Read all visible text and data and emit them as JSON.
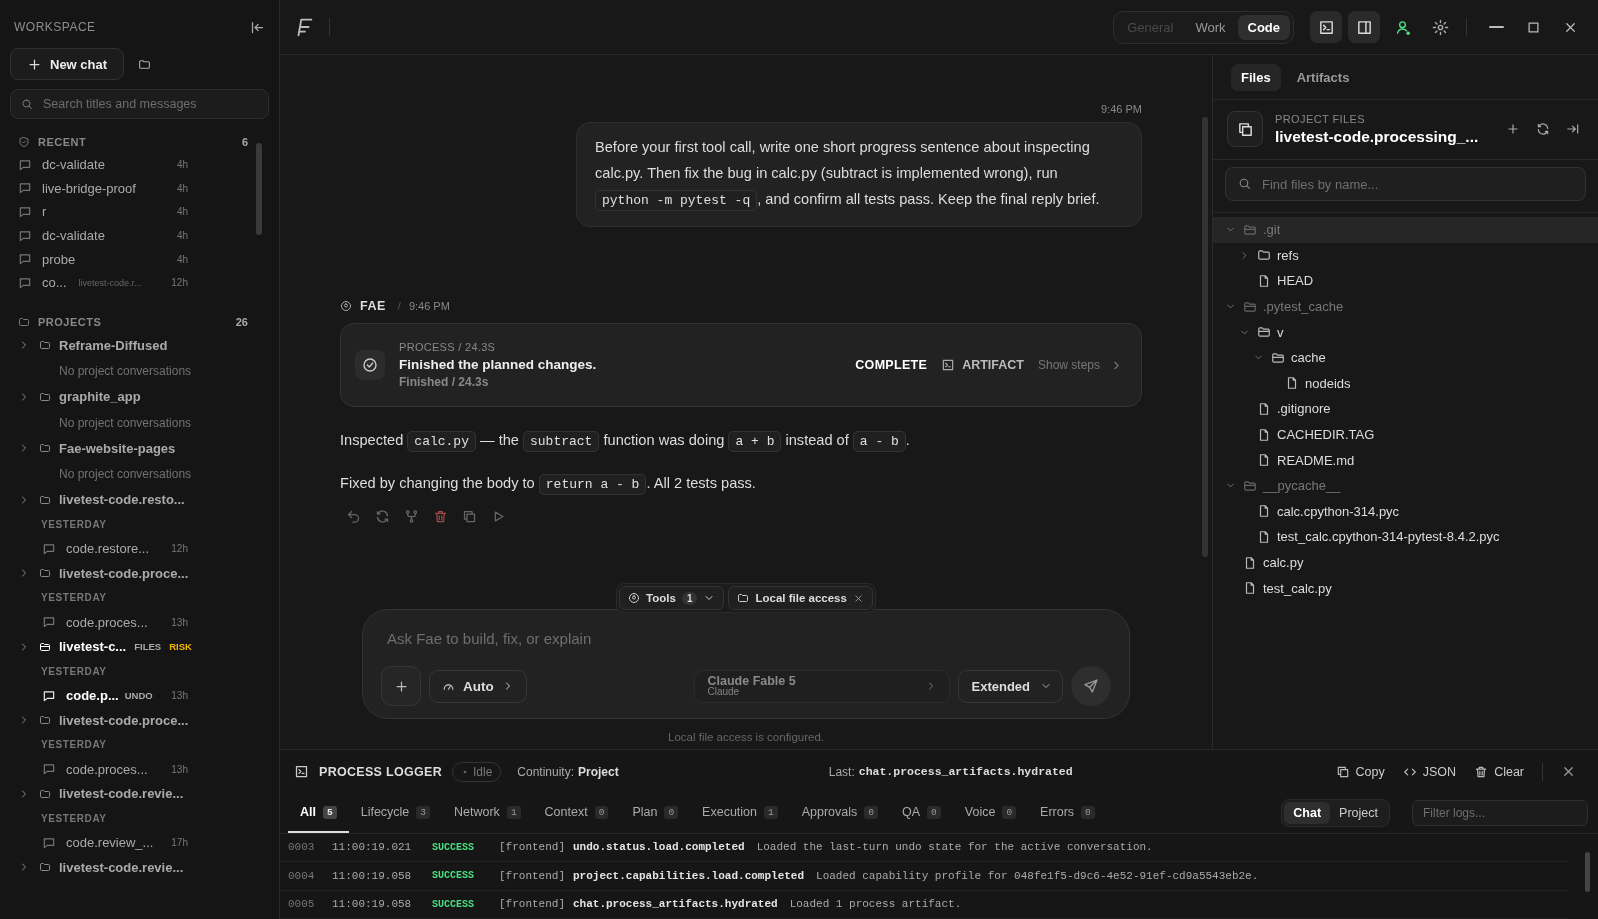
{
  "sidebar": {
    "title": "WORKSPACE",
    "new_chat": "New chat",
    "search_placeholder": "Search titles and messages",
    "recent": {
      "label": "RECENT",
      "count": "6",
      "items": [
        {
          "title": "dc-validate",
          "time": "4h"
        },
        {
          "title": "live-bridge-proof",
          "time": "4h"
        },
        {
          "title": "r",
          "time": "4h"
        },
        {
          "title": "dc-validate",
          "time": "4h"
        },
        {
          "title": "probe",
          "time": "4h"
        },
        {
          "title": "co...",
          "project": "livetest-code.r...",
          "time": "12h"
        }
      ]
    },
    "projects": {
      "label": "PROJECTS",
      "count": "26",
      "items": [
        {
          "name": "Reframe-Diffused",
          "expanded": false,
          "active": false,
          "empty": "No project conversations"
        },
        {
          "name": "graphite_app",
          "expanded": false,
          "active": false,
          "empty": "No project conversations"
        },
        {
          "name": "Fae-website-pages",
          "expanded": false,
          "active": false,
          "empty": "No project conversations"
        },
        {
          "name": "livetest-code.resto...",
          "expanded": false,
          "active": false,
          "group": "YESTERDAY",
          "chats": [
            {
              "title": "code.restore...",
              "time": "12h",
              "active": false
            }
          ]
        },
        {
          "name": "livetest-code.proce...",
          "expanded": false,
          "active": false,
          "group": "YESTERDAY",
          "chats": [
            {
              "title": "code.proces...",
              "time": "13h",
              "active": false
            }
          ]
        },
        {
          "name": "livetest-c...",
          "expanded": false,
          "active": true,
          "badges": [
            {
              "text": "FILES",
              "kind": "files"
            },
            {
              "text": "RISK",
              "kind": "risk"
            }
          ],
          "group": "YESTERDAY",
          "chats": [
            {
              "title": "code.p...",
              "badge": "UNDO",
              "time": "13h",
              "active": true
            }
          ]
        },
        {
          "name": "livetest-code.proce...",
          "expanded": false,
          "active": false,
          "group": "YESTERDAY",
          "chats": [
            {
              "title": "code.proces...",
              "time": "13h",
              "active": false
            }
          ]
        },
        {
          "name": "livetest-code.revie...",
          "expanded": false,
          "active": false,
          "group": "YESTERDAY",
          "chats": [
            {
              "title": "code.review_...",
              "time": "17h",
              "active": false
            }
          ]
        },
        {
          "name": "livetest-code.revie...",
          "expanded": false,
          "active": false
        }
      ]
    }
  },
  "topbar": {
    "modes": [
      {
        "label": "General",
        "selected": false,
        "disabled": true
      },
      {
        "label": "Work",
        "selected": false,
        "disabled": false
      },
      {
        "label": "Code",
        "selected": true,
        "disabled": false
      }
    ],
    "tools": [
      {
        "kind": "terminal",
        "on": true
      },
      {
        "kind": "panel",
        "on": true
      },
      {
        "kind": "account",
        "on": false
      },
      {
        "kind": "settings",
        "on": false
      }
    ]
  },
  "chat": {
    "messages": [
      {
        "kind": "user",
        "time": "9:46 PM",
        "segments": [
          {
            "kind": "text",
            "text": "Before your first tool call, write one short progress sentence about inspecting calc.py. Then fix the bug in calc.py (subtract is implemented wrong), run "
          },
          {
            "kind": "code",
            "text": "python -m pytest -q"
          },
          {
            "kind": "text",
            "text": ", and confirm all tests pass. Keep the final reply brief."
          }
        ]
      },
      {
        "kind": "assistant",
        "author": "FAE",
        "separator": "/",
        "time": "9:46 PM",
        "process": {
          "label": "PROCESS / 24.3S",
          "title": "Finished the planned changes.",
          "detail": "Finished / 24.3s",
          "status": "COMPLETE",
          "artifact": "ARTIFACT",
          "steps": "Show steps"
        },
        "paragraphs": [
          [
            {
              "kind": "text",
              "text": "Inspected "
            },
            {
              "kind": "code",
              "text": "calc.py"
            },
            {
              "kind": "text",
              "text": " — the "
            },
            {
              "kind": "code",
              "text": "subtract"
            },
            {
              "kind": "text",
              "text": " function was doing "
            },
            {
              "kind": "code",
              "text": "a + b"
            },
            {
              "kind": "text",
              "text": " instead of "
            },
            {
              "kind": "code",
              "text": "a - b"
            },
            {
              "kind": "text",
              "text": "."
            }
          ],
          [
            {
              "kind": "text",
              "text": "Fixed by changing the body to "
            },
            {
              "kind": "code",
              "text": "return a - b"
            },
            {
              "kind": "text",
              "text": ". All 2 tests pass."
            }
          ]
        ]
      }
    ],
    "composer": {
      "tools_label": "Tools",
      "tools_count": "1",
      "access_chip": "Local file access",
      "placeholder": "Ask Fae to build, fix, or explain",
      "mode": "Auto",
      "model": {
        "name": "Claude Fable 5",
        "provider": "Claude",
        "disabled": true
      },
      "effort": "Extended",
      "note": "Local file access is configured."
    }
  },
  "files_panel": {
    "tabs": [
      {
        "label": "Files",
        "selected": true
      },
      {
        "label": "Artifacts",
        "selected": false
      }
    ],
    "label": "PROJECT FILES",
    "project": "livetest-code.processing_...",
    "search_placeholder": "Find files by name...",
    "tree": [
      {
        "name": ".git",
        "kind": "folder",
        "expanded": true,
        "ignored": true,
        "selected": true,
        "children": [
          {
            "name": "refs",
            "kind": "folder",
            "expanded": false,
            "ignored": false,
            "selected": false
          },
          {
            "name": "HEAD",
            "kind": "file",
            "selected": false
          }
        ]
      },
      {
        "name": ".pytest_cache",
        "kind": "folder",
        "expanded": true,
        "ignored": true,
        "selected": false,
        "children": [
          {
            "name": "v",
            "kind": "folder",
            "expanded": true,
            "ignored": false,
            "selected": false,
            "children": [
              {
                "name": "cache",
                "kind": "folder",
                "expanded": true,
                "ignored": false,
                "selected": false,
                "children": [
                  {
                    "name": "nodeids",
                    "kind": "file",
                    "selected": false
                  }
                ]
              }
            ]
          },
          {
            "name": ".gitignore",
            "kind": "file",
            "selected": false
          },
          {
            "name": "CACHEDIR.TAG",
            "kind": "file",
            "selected": false
          },
          {
            "name": "README.md",
            "kind": "file",
            "selected": false
          }
        ]
      },
      {
        "name": "__pycache__",
        "kind": "folder",
        "expanded": true,
        "ignored": true,
        "selected": false,
        "children": [
          {
            "name": "calc.cpython-314.pyc",
            "kind": "file",
            "selected": false
          },
          {
            "name": "test_calc.cpython-314-pytest-8.4.2.pyc",
            "kind": "file",
            "selected": false
          }
        ]
      },
      {
        "name": "calc.py",
        "kind": "file",
        "selected": false
      },
      {
        "name": "test_calc.py",
        "kind": "file",
        "selected": false
      }
    ]
  },
  "logger": {
    "title": "PROCESS LOGGER",
    "status": "Idle",
    "continuity_label": "Continuity:",
    "continuity_value": "Project",
    "last_label": "Last:",
    "last_event": "chat.process_artifacts.hydrated",
    "actions": [
      {
        "kind": "copy",
        "label": "Copy"
      },
      {
        "kind": "json",
        "label": "JSON"
      },
      {
        "kind": "clear",
        "label": "Clear"
      }
    ],
    "tabs": [
      {
        "label": "All",
        "count": "5",
        "selected": true
      },
      {
        "label": "Lifecycle",
        "count": "3",
        "selected": false
      },
      {
        "label": "Network",
        "count": "1",
        "selected": false
      },
      {
        "label": "Context",
        "count": "0",
        "selected": false
      },
      {
        "label": "Plan",
        "count": "0",
        "selected": false
      },
      {
        "label": "Execution",
        "count": "1",
        "selected": false
      },
      {
        "label": "Approvals",
        "count": "0",
        "selected": false
      },
      {
        "label": "QA",
        "count": "0",
        "selected": false
      },
      {
        "label": "Voice",
        "count": "0",
        "selected": false
      },
      {
        "label": "Errors",
        "count": "0",
        "selected": false
      }
    ],
    "scopes": [
      {
        "label": "Chat",
        "selected": true
      },
      {
        "label": "Project",
        "selected": false
      }
    ],
    "filter_placeholder": "Filter logs...",
    "rows": [
      {
        "id": "0003",
        "time": "11:00:19.021",
        "level": "SUCCESS",
        "kind": "success",
        "source": "[frontend]",
        "event": "undo.status.load.completed",
        "message": "Loaded the last-turn undo state for the active conversation."
      },
      {
        "id": "0004",
        "time": "11:00:19.058",
        "level": "SUCCESS",
        "kind": "success",
        "source": "[frontend]",
        "event": "project.capabilities.load.completed",
        "message": "Loaded capability profile for 048fe1f5-d9c6-4e52-91ef-cd9a5543eb2e."
      },
      {
        "id": "0005",
        "time": "11:00:19.058",
        "level": "SUCCESS",
        "kind": "success",
        "source": "[frontend]",
        "event": "chat.process_artifacts.hydrated",
        "message": "Loaded 1 process artifact."
      }
    ]
  }
}
